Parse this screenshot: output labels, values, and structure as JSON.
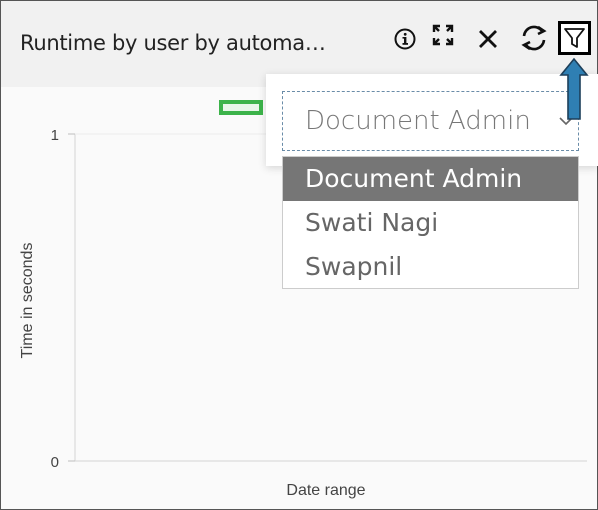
{
  "widget": {
    "title": "Runtime by user by automa…",
    "icons": [
      "info-icon",
      "expand-icon",
      "close-icon",
      "refresh-icon",
      "filter-icon"
    ]
  },
  "filter": {
    "selected_value": "Document Admin",
    "options": [
      "Document Admin",
      "Swati Nagi",
      "Swapnil"
    ]
  },
  "chart_data": {
    "type": "bar",
    "xlabel": "Date range",
    "ylabel": "Time in seconds",
    "ylim": [
      0,
      1
    ],
    "yticks": [
      "1",
      "0"
    ],
    "categories": [],
    "series": []
  },
  "colors": {
    "legend_swatch": "#3cb34a",
    "annotation_arrow": "#2f7fb3",
    "selected_option_bg": "#767676"
  }
}
